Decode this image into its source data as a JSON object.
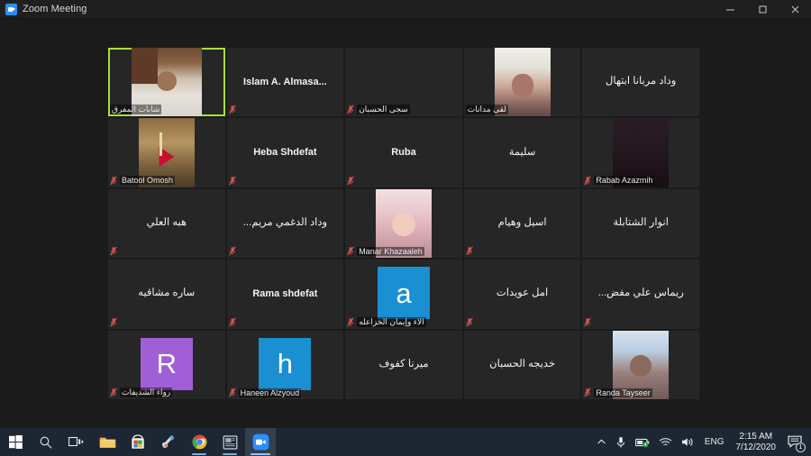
{
  "window": {
    "title": "Zoom Meeting",
    "app_icon": "zoom-camera-icon",
    "controls": {
      "minimize": "minimize-icon",
      "maximize": "maximize-icon",
      "close": "close-icon"
    }
  },
  "colors": {
    "active_speaker_border": "#a7e03c",
    "tile_background": "#262626",
    "stage_background": "#1b1b1b",
    "titlebar_background": "#1f1f1f",
    "taskbar_background": "#1d2733",
    "muted_icon": "#d14b4b",
    "avatar_blue": "#1a8fd1",
    "avatar_purple": "#a05fd6"
  },
  "gallery": {
    "columns": 5,
    "rows": 5,
    "participants": [
      {
        "name": "شابات المفرق",
        "rtl": true,
        "label_position": "footer",
        "media": "video",
        "video_tone": "room-brown",
        "active_speaker": true,
        "muted": false
      },
      {
        "name": "Islam A. Almasa...",
        "rtl": false,
        "label_position": "center",
        "media": "none",
        "muted": true
      },
      {
        "name": "سجى الحسبان",
        "rtl": true,
        "label_position": "footer",
        "media": "none",
        "muted": true
      },
      {
        "name": "لقى مدانات",
        "rtl": true,
        "label_position": "footer",
        "media": "video",
        "video_tone": "indoor-light",
        "muted": false
      },
      {
        "name": "وداد مربانا ابتهال",
        "rtl": true,
        "label_position": "center",
        "media": "none",
        "muted": false
      },
      {
        "name": "Batool Omosh",
        "rtl": false,
        "label_position": "footer",
        "media": "video",
        "video_tone": "flag-photo",
        "muted": true
      },
      {
        "name": "Heba Shdefat",
        "rtl": false,
        "label_position": "center",
        "media": "none",
        "muted": true
      },
      {
        "name": "Ruba",
        "rtl": false,
        "label_position": "center",
        "media": "none",
        "muted": true
      },
      {
        "name": "سليمة",
        "rtl": true,
        "label_position": "center",
        "media": "none",
        "muted": false
      },
      {
        "name": "Rabab Azazmih",
        "rtl": false,
        "label_position": "footer",
        "media": "video",
        "video_tone": "dark-room",
        "muted": true
      },
      {
        "name": "هبه العلي",
        "rtl": true,
        "label_position": "center",
        "media": "none",
        "muted": true
      },
      {
        "name": "وداد الدغمي مريم...",
        "rtl": true,
        "label_position": "center",
        "media": "none",
        "muted": true
      },
      {
        "name": "Manar Khazaaleh",
        "rtl": false,
        "label_position": "footer",
        "media": "video",
        "video_tone": "portrait-pink",
        "muted": true
      },
      {
        "name": "اسيل  وهيام",
        "rtl": true,
        "label_position": "center",
        "media": "none",
        "muted": true
      },
      {
        "name": "أنوار الشتابلة",
        "rtl": true,
        "label_position": "center",
        "media": "none",
        "muted": false
      },
      {
        "name": "ساره مشاقيه",
        "rtl": true,
        "label_position": "center",
        "media": "none",
        "muted": true
      },
      {
        "name": "Rama shdefat",
        "rtl": false,
        "label_position": "center",
        "media": "none",
        "muted": true
      },
      {
        "name": "الاء وإيمان الخزاعله",
        "rtl": true,
        "label_position": "footer",
        "media": "avatar",
        "avatar_letter": "a",
        "avatar_color": "#1a8fd1",
        "muted": true
      },
      {
        "name": "امل عويدات",
        "rtl": true,
        "label_position": "center",
        "media": "none",
        "muted": true
      },
      {
        "name": "ريماس علي مفض...",
        "rtl": true,
        "label_position": "center",
        "media": "none",
        "muted": true
      },
      {
        "name": "رواء الشديفات",
        "rtl": true,
        "label_position": "footer",
        "media": "avatar",
        "avatar_letter": "R",
        "avatar_color": "#a05fd6",
        "muted": true
      },
      {
        "name": "Haneen Alzyoud",
        "rtl": false,
        "label_position": "footer",
        "media": "avatar",
        "avatar_letter": "h",
        "avatar_color": "#1a8fd1",
        "muted": true
      },
      {
        "name": "ميرنا كفوف",
        "rtl": true,
        "label_position": "center",
        "media": "none",
        "muted": false
      },
      {
        "name": "خديجه الحسبان",
        "rtl": true,
        "label_position": "center",
        "media": "none",
        "muted": false
      },
      {
        "name": "Randa Tayseer",
        "rtl": false,
        "label_position": "footer",
        "media": "video",
        "video_tone": "portrait-blue",
        "muted": true
      }
    ]
  },
  "taskbar": {
    "buttons": [
      {
        "name": "start-button",
        "icon": "windows-logo-icon"
      },
      {
        "name": "search-button",
        "icon": "search-icon"
      },
      {
        "name": "task-view-button",
        "icon": "task-view-icon"
      },
      {
        "name": "file-explorer-button",
        "icon": "folder-icon"
      },
      {
        "name": "microsoft-store-button",
        "icon": "store-icon"
      },
      {
        "name": "paint-button",
        "icon": "paint-icon"
      },
      {
        "name": "chrome-button",
        "icon": "chrome-icon"
      },
      {
        "name": "news-button",
        "icon": "news-icon"
      },
      {
        "name": "zoom-button",
        "icon": "zoom-camera-icon"
      }
    ],
    "tray": {
      "show_hidden": "chevron-up-icon",
      "microphone": "microphone-icon",
      "battery": "battery-icon",
      "network": "wifi-icon",
      "volume": "speaker-icon",
      "language": "ENG",
      "time": "2:15 AM",
      "date": "7/12/2020",
      "notifications_icon": "action-center-icon",
      "notifications_count": "1"
    }
  }
}
